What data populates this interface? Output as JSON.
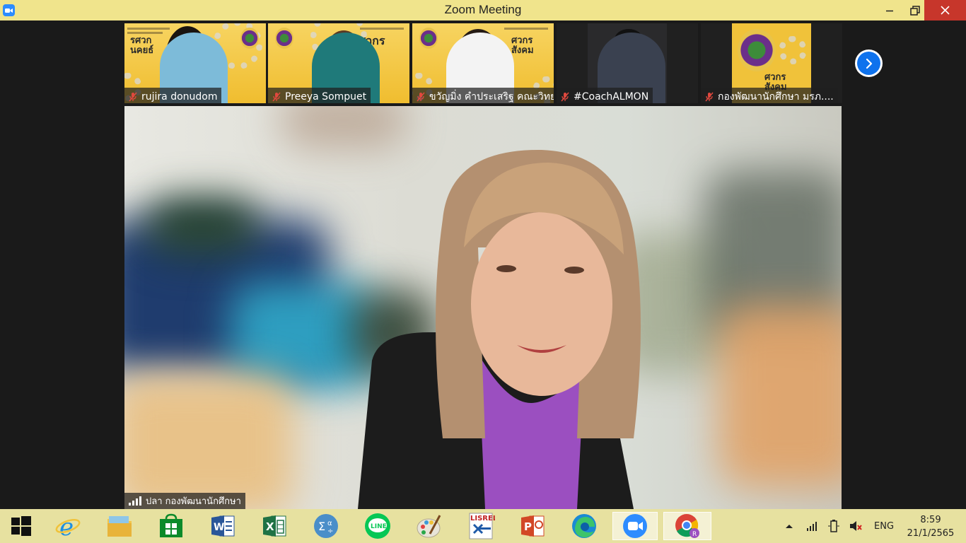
{
  "window": {
    "title": "Zoom Meeting"
  },
  "thumbnails": [
    {
      "name": "rujira donudom",
      "poster": "รศวก\nนคยธ์"
    },
    {
      "name": "Preeya Sompuet",
      "poster": ""
    },
    {
      "name": "ขวัญมิ่ง คำประเสริฐ คณะวิทยา...",
      "poster": "ศวกร\nสังคม"
    },
    {
      "name": "#CoachALMON",
      "poster": ""
    },
    {
      "name": "กองพัฒนานักศึกษา มรภ....",
      "poster": "ศวกร\nสังคม"
    }
  ],
  "active_speaker": {
    "name": "ปลา  กองพัฒนานักศึกษา"
  },
  "taskbar": {
    "apps": [
      "start-button",
      "internet-explorer",
      "file-explorer",
      "store",
      "word",
      "excel",
      "math-input",
      "line",
      "paint",
      "lisrel",
      "powerpoint",
      "edge",
      "zoom",
      "chrome"
    ]
  },
  "tray": {
    "language": "ENG",
    "time": "8:59",
    "date": "21/1/2565"
  },
  "colors": {
    "title_bar": "#f0e48c",
    "taskbar": "#e7e1a0",
    "close": "#c7362b",
    "zoom_blue": "#0e72ed"
  }
}
